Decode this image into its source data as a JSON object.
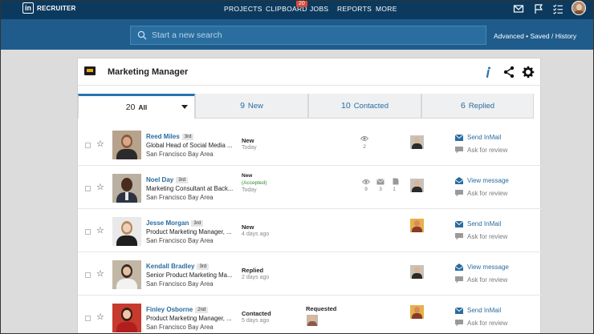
{
  "app": {
    "logo_mark": "in",
    "logo_text": "RECRUITER"
  },
  "nav": {
    "items": [
      "PROJECTS",
      "CLIPBOARD",
      "JOBS",
      "REPORTS",
      "MORE"
    ],
    "clipboard_badge": "20",
    "icons": [
      "mail-icon",
      "flag-icon",
      "tasks-icon",
      "profile-avatar"
    ]
  },
  "search": {
    "placeholder": "Start a new search",
    "links": "Advanced • Saved / History"
  },
  "project": {
    "title": "Marketing Manager",
    "icons": [
      "info-icon",
      "share-icon",
      "settings-icon"
    ]
  },
  "tabs": [
    {
      "count": "20",
      "label": "All"
    },
    {
      "count": "9",
      "label": "New"
    },
    {
      "count": "10",
      "label": "Contacted"
    },
    {
      "count": "6",
      "label": "Replied"
    }
  ],
  "candidates": [
    {
      "name": "Reed Miles",
      "degree": "3rd",
      "title": "Global Head of Social Media ...",
      "location": "San Francisco Bay Area",
      "status": "New",
      "status_sub": "Today",
      "views": "2",
      "action": "Send InMail",
      "review": "Ask for review"
    },
    {
      "name": "Noel Day",
      "degree": "3rd",
      "title": "Marketing Consultant at Back...",
      "location": "San Francisco Bay Area",
      "status": "New",
      "status_note": "(Accepted)",
      "status_sub": "Today",
      "views": "9",
      "messages": "3",
      "notes": "1",
      "action": "View message",
      "review": "Ask for review"
    },
    {
      "name": "Jesse Morgan",
      "degree": "3rd",
      "title": "Product Marketing Manager, ...",
      "location": "San Francisco Bay Area",
      "status": "New",
      "status_sub": "4 days ago",
      "action": "Send InMail",
      "review": "Ask for review"
    },
    {
      "name": "Kendall Bradley",
      "degree": "3rd",
      "title": "Senior Product Marketing Ma...",
      "location": "San Francisco Bay Area",
      "status": "Replied",
      "status_sub": "2 days ago",
      "action": "View message",
      "review": "Ask for review"
    },
    {
      "name": "Finley Osborne",
      "degree": "2nd",
      "title": "Product Marketing Manager, ...",
      "location": "San Francisco Bay Area",
      "status": "Contacted",
      "status_sub": "5 days ago",
      "requested": "Requested",
      "action": "Send InMail",
      "review": "Ask for review"
    }
  ],
  "colors": {
    "nav_bg": "#0c3a5e",
    "search_band": "#1f5c8b",
    "link": "#2a6c9e",
    "tab_active": "#2574b0",
    "badge": "#d94a3a",
    "accepted": "#2e8b2e"
  }
}
